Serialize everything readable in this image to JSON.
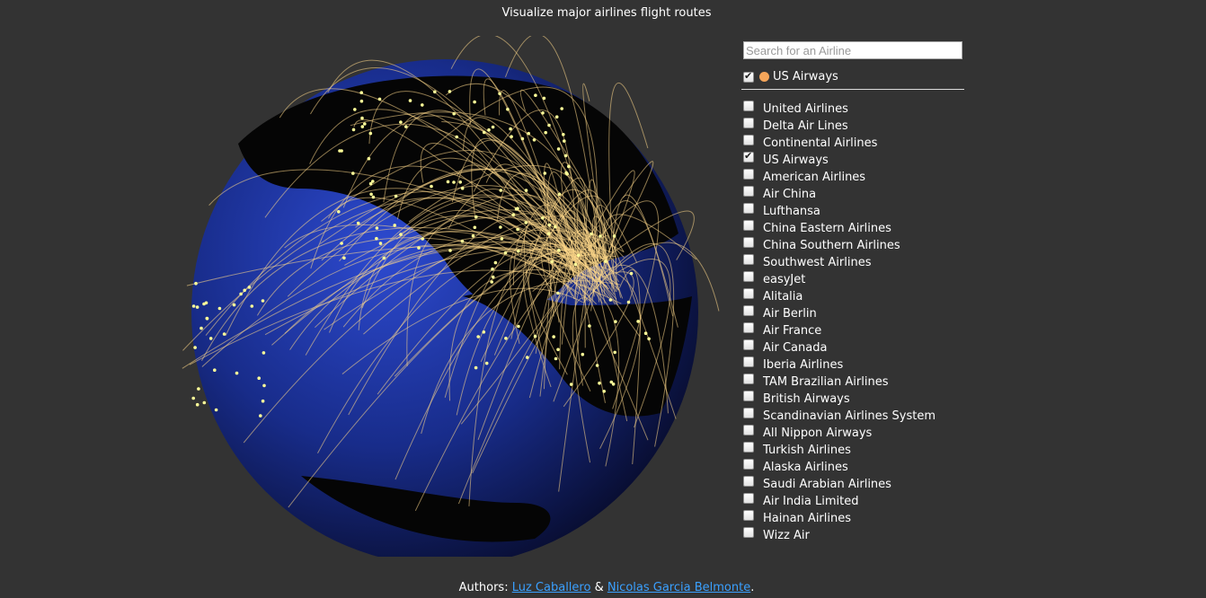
{
  "header": {
    "title": "Visualize major airlines flight routes"
  },
  "search": {
    "placeholder": "Search for an Airline"
  },
  "selected": [
    {
      "label": "US Airways",
      "color": "#f5a55a",
      "checked": true
    }
  ],
  "airlines": [
    {
      "label": "United Airlines",
      "checked": false
    },
    {
      "label": "Delta Air Lines",
      "checked": false
    },
    {
      "label": "Continental Airlines",
      "checked": false
    },
    {
      "label": "US Airways",
      "checked": true
    },
    {
      "label": "American Airlines",
      "checked": false
    },
    {
      "label": "Air China",
      "checked": false
    },
    {
      "label": "Lufthansa",
      "checked": false
    },
    {
      "label": "China Eastern Airlines",
      "checked": false
    },
    {
      "label": "China Southern Airlines",
      "checked": false
    },
    {
      "label": "Southwest Airlines",
      "checked": false
    },
    {
      "label": "easyJet",
      "checked": false
    },
    {
      "label": "Alitalia",
      "checked": false
    },
    {
      "label": "Air Berlin",
      "checked": false
    },
    {
      "label": "Air France",
      "checked": false
    },
    {
      "label": "Air Canada",
      "checked": false
    },
    {
      "label": "Iberia Airlines",
      "checked": false
    },
    {
      "label": "TAM Brazilian Airlines",
      "checked": false
    },
    {
      "label": "British Airways",
      "checked": false
    },
    {
      "label": "Scandinavian Airlines System",
      "checked": false
    },
    {
      "label": "All Nippon Airways",
      "checked": false
    },
    {
      "label": "Turkish Airlines",
      "checked": false
    },
    {
      "label": "Alaska Airlines",
      "checked": false
    },
    {
      "label": "Saudi Arabian Airlines",
      "checked": false
    },
    {
      "label": "Air India Limited",
      "checked": false
    },
    {
      "label": "Hainan Airlines",
      "checked": false
    },
    {
      "label": "Wizz Air",
      "checked": false
    }
  ],
  "footer": {
    "prefix": "Authors: ",
    "author1": "Luz Caballero",
    "separator": " & ",
    "author2": "Nicolas Garcia Belmonte",
    "suffix": "."
  },
  "colors": {
    "background": "#333333",
    "route": "#ffd98a",
    "airport": "#ffff99",
    "ocean": "#1a2a8c",
    "land": "#050505",
    "link": "#3aa0ff"
  }
}
